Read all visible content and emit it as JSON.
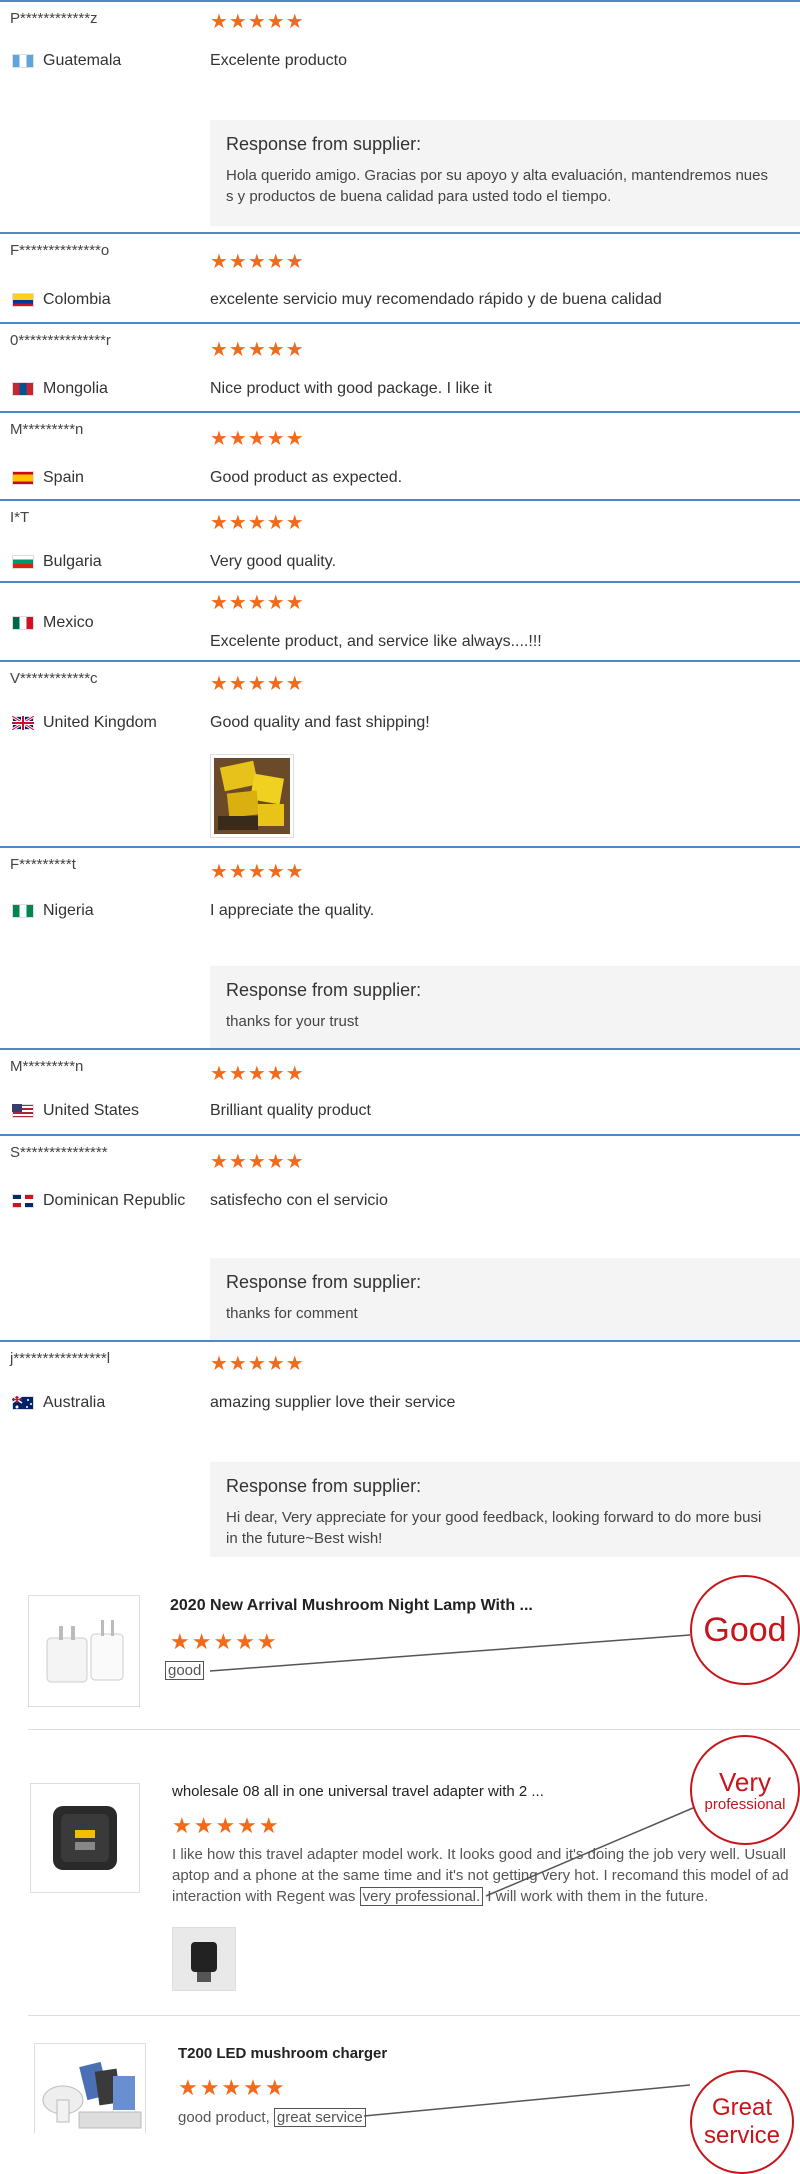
{
  "star_glyph": "★★★★★",
  "reviews": [
    {
      "name": "P************z",
      "country": "Guatemala",
      "text": "Excelente producto",
      "response_title": "Response from supplier:",
      "response_text": "Hola querido amigo. Gracias por su apoyo y alta evaluación, mantendremos nues\ns y productos de buena calidad para usted todo el tiempo."
    },
    {
      "name": "F**************o",
      "country": "Colombia",
      "text": "excelente servicio muy recomendado rápido y de buena calidad"
    },
    {
      "name": "0***************r",
      "country": "Mongolia",
      "text": "Nice product with good package. I like it"
    },
    {
      "name": "M*********n",
      "country": "Spain",
      "text": "Good product as expected."
    },
    {
      "name": "I*T",
      "country": "Bulgaria",
      "text": "Very good quality."
    },
    {
      "name": "",
      "country": "Mexico",
      "text": "Excelente product, and service like always....!!!"
    },
    {
      "name": "V************c",
      "country": "United Kingdom",
      "text": "Good quality and fast shipping!"
    },
    {
      "name": "F*********t",
      "country": "Nigeria",
      "text": "I appreciate the quality.",
      "response_title": "Response from supplier:",
      "response_text": "thanks for your trust"
    },
    {
      "name": "M*********n",
      "country": "United States",
      "text": "Brilliant quality product"
    },
    {
      "name": "S***************",
      "country": "Dominican Republic",
      "text": "satisfecho con el servicio",
      "response_title": "Response from supplier:",
      "response_text": "thanks for comment"
    },
    {
      "name": "j****************l",
      "country": "Australia",
      "text": "amazing supplier love their service",
      "response_title": "Response from supplier:",
      "response_text": "Hi dear, Very appreciate for your good feedback, looking forward to do more busi\nin the future~Best wish!"
    }
  ],
  "products": [
    {
      "title": "2020 New Arrival Mushroom Night Lamp With ...",
      "highlight": "good",
      "badge": "Good"
    },
    {
      "title": "wholesale 08 all in one universal travel adapter with 2 ...",
      "text_line1": "I like how this travel adapter model work. It looks good and it's doing the job very well. Usuall",
      "text_line2": "aptop and a phone at the same time and it's not getting very hot. I recomand this model of ad",
      "text_line3_pre": "interaction with Regent was ",
      "highlight": "very professional.",
      "text_line3_post": " I will work with them in the future.",
      "badge_line1": "Very",
      "badge_line2": "professional"
    },
    {
      "title": "T200 LED mushroom charger",
      "text_pre": "good product, ",
      "highlight": "great service",
      "badge_line1": "Great",
      "badge_line2": "service"
    }
  ]
}
